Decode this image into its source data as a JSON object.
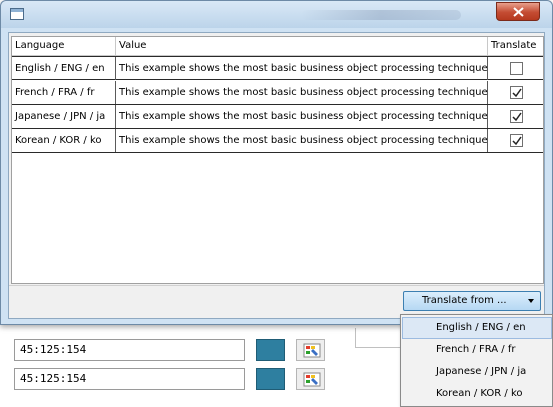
{
  "dialog": {
    "table": {
      "headers": [
        "Language",
        "Value",
        "Translate"
      ],
      "rows": [
        {
          "language": "English / ENG / en",
          "value": "This example shows the most basic business object processing techniques.",
          "translate": false
        },
        {
          "language": "French / FRA / fr",
          "value": "This example shows the most basic business object processing techniques.",
          "translate": true
        },
        {
          "language": "Japanese / JPN / ja",
          "value": "This example shows the most basic business object processing techniques.",
          "translate": true
        },
        {
          "language": "Korean / KOR / ko",
          "value": "This example shows the most basic business object processing techniques.",
          "translate": true
        }
      ]
    },
    "translate_button_label": "Translate from ...",
    "menu_items": [
      "English / ENG / en",
      "French / FRA / fr",
      "Japanese / JPN / ja",
      "Korean / KOR / ko"
    ],
    "menu_highlighted_index": 0
  },
  "background": {
    "fields": [
      "45:125:154",
      "45:125:154"
    ],
    "swatch_color": "#2e7fa0"
  },
  "icons": {
    "window": "window-icon",
    "close": "close-icon",
    "checkbox_check": "check-icon",
    "dropdown": "chevron-down-icon",
    "color_picker": "color-picker-icon"
  },
  "colors": {
    "title_bar": "#cfe2f3",
    "close_button": "#c44c33",
    "button_border": "#3c7fb1",
    "menu_highlight": "#dce8f5"
  }
}
